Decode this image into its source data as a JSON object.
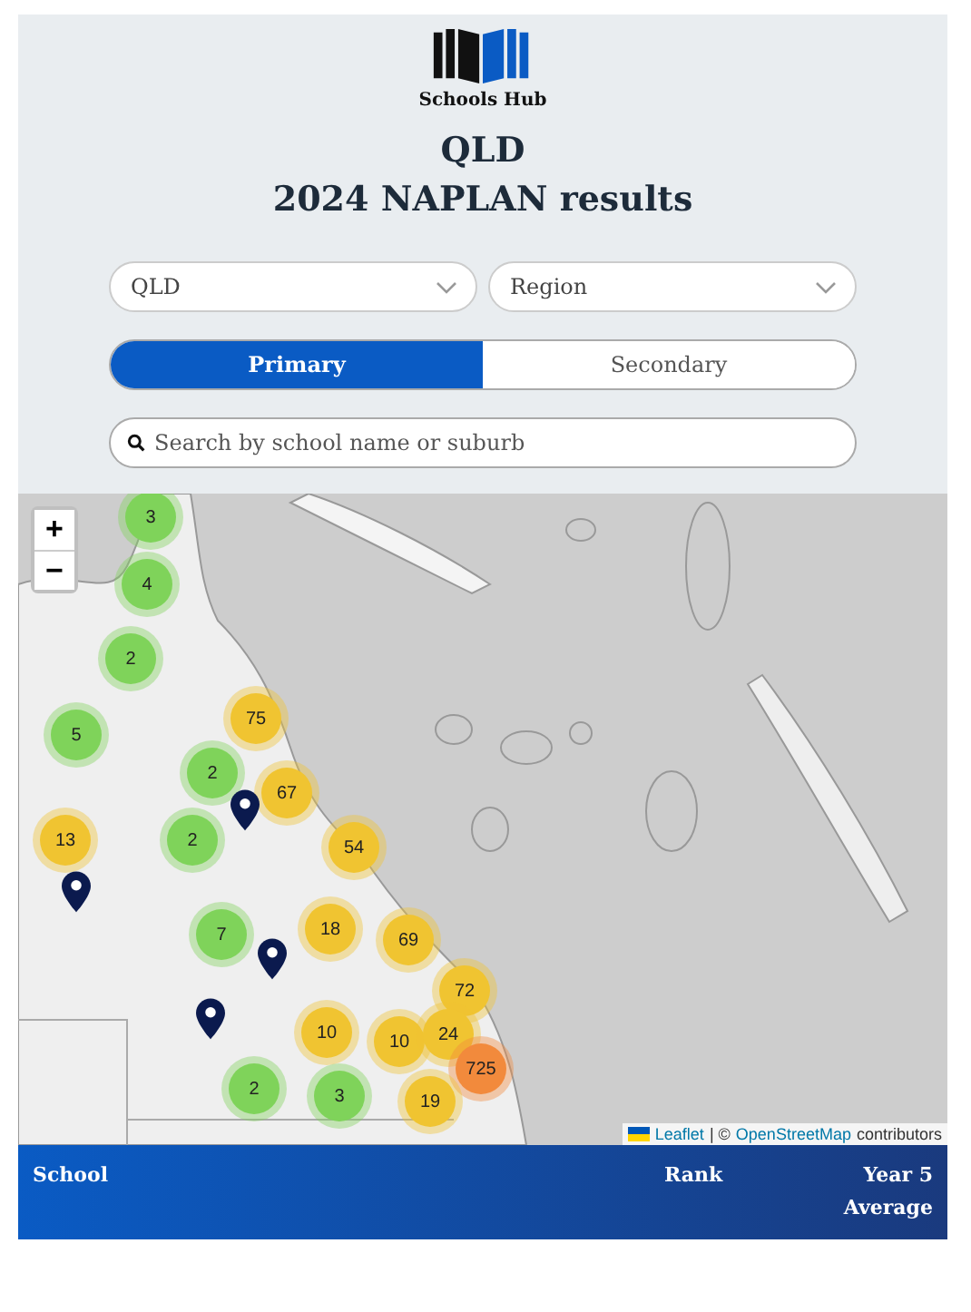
{
  "brand": {
    "name": "Schools Hub"
  },
  "title": "QLD",
  "subtitle": "2024 NAPLAN results",
  "filters": [
    {
      "value": "QLD"
    },
    {
      "value": "Region"
    }
  ],
  "tabs": [
    {
      "label": "Primary",
      "selected": true
    },
    {
      "label": "Secondary",
      "selected": false
    }
  ],
  "search": {
    "placeholder": "Search by school name or suburb"
  },
  "map": {
    "zoom_in": "+",
    "zoom_out": "−",
    "clusters": [
      {
        "count": "3",
        "color": "#7fd35a"
      },
      {
        "count": "4",
        "color": "#7fd35a"
      },
      {
        "count": "2",
        "color": "#7fd35a"
      },
      {
        "count": "5",
        "color": "#7fd35a"
      },
      {
        "count": "75",
        "color": "#f0c431"
      },
      {
        "count": "2",
        "color": "#7fd35a"
      },
      {
        "count": "67",
        "color": "#f0c431"
      },
      {
        "count": "13",
        "color": "#f0c431"
      },
      {
        "count": "2",
        "color": "#7fd35a"
      },
      {
        "count": "54",
        "color": "#f0c431"
      },
      {
        "count": "7",
        "color": "#7fd35a"
      },
      {
        "count": "18",
        "color": "#f0c431"
      },
      {
        "count": "69",
        "color": "#f0c431"
      },
      {
        "count": "72",
        "color": "#f0c431"
      },
      {
        "count": "10",
        "color": "#f0c431"
      },
      {
        "count": "10",
        "color": "#f0c431"
      },
      {
        "count": "24",
        "color": "#f0c431"
      },
      {
        "count": "725",
        "color": "#f28a3c"
      },
      {
        "count": "19",
        "color": "#f0c431"
      },
      {
        "count": "2",
        "color": "#7fd35a"
      },
      {
        "count": "3",
        "color": "#7fd35a"
      }
    ],
    "markers": [
      {
        "kind": "pin"
      },
      {
        "kind": "pin"
      },
      {
        "kind": "pin"
      },
      {
        "kind": "pin"
      }
    ],
    "attribution": {
      "link1": "Leaflet",
      "separator": "| ©",
      "link2": "OpenStreetMap",
      "suffix": "contributors"
    }
  },
  "table": {
    "columns": [
      "School",
      "Rank",
      "Year 5 Average"
    ]
  }
}
